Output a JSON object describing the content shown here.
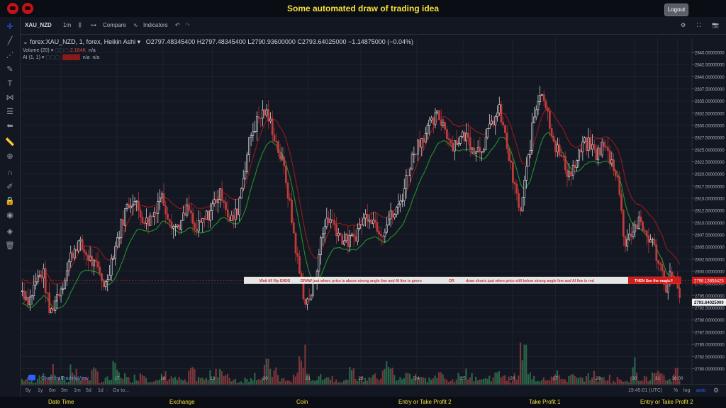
{
  "header": {
    "title": "Some automated draw of trading idea",
    "logout_label": "Logout"
  },
  "toolbar": {
    "symbol": "XAU_NZD",
    "interval": "1m",
    "compare_label": "Compare",
    "indicators_label": "Indicators"
  },
  "legend": {
    "symbol_line": "forex:XAU_NZD, 1, forex, Heikin Ashi",
    "ohlc": "O2797.48345400  H2797.48345400  L2790.93600000  C2793.64025000  −1.14875000 (−0.04%)",
    "volume_label": "Volume (20)",
    "volume_value": "2.164K",
    "volume_na": "n/a",
    "ai_label": "AI (1, 1)",
    "ai_value1": "n/a",
    "ai_value2": "n/a"
  },
  "annotation": {
    "text1": "Wait till flip ENDS",
    "text2": "DRAW just when:  price is above strong angle line and AI line is green",
    "text3": "OR",
    "text4": "draw shorts just when price still below strong angle line and AI line is red",
    "text5": "THEN See the magic!!"
  },
  "price_axis": {
    "ticks": [
      "2845.00000000",
      "2842.50000000",
      "2840.00000000",
      "2837.50000000",
      "2835.00000000",
      "2832.50000000",
      "2830.00000000",
      "2827.50000000",
      "2825.00000000",
      "2822.50000000",
      "2820.00000000",
      "2817.50000000",
      "2815.00000000",
      "2812.50000000",
      "2810.00000000",
      "2807.50000000",
      "2805.00000000",
      "2802.50000000",
      "2800.00000000",
      "2797.50000000",
      "2795.00000000",
      "2792.50000000",
      "2790.00000000",
      "2787.50000000",
      "2785.00000000",
      "2782.50000000",
      "2780.00000000"
    ],
    "label_red": "2798.13858425",
    "label_current": "2793.64025000"
  },
  "time_axis": {
    "labels": [
      "16",
      "17",
      "18",
      "19",
      "20",
      "21",
      "23",
      "24",
      "25",
      "26",
      "27",
      "28",
      "30",
      "31",
      "18:00"
    ]
  },
  "bottom": {
    "ranges": [
      "5y",
      "1y",
      "6m",
      "3m",
      "1m",
      "5d",
      "1d"
    ],
    "goto": "Go to...",
    "clock": "19:45:01 (UTC)",
    "percent": "%",
    "log": "log",
    "auto": "auto"
  },
  "watermark": "Chart by TradingView",
  "footer": {
    "columns": [
      "Date Time",
      "Exchange",
      "Coin",
      "Entry or Take Profit 2",
      "Take Profit 1",
      "Entry or Take Profit 2"
    ]
  },
  "chart_data": {
    "type": "candlestick",
    "ylim": [
      2778.9,
      2847.9
    ],
    "current_price": 2793.64025,
    "red_line_price": 2798.13858425,
    "close_path": [
      2796,
      2794,
      2798,
      2800,
      2791,
      2795,
      2798,
      2803,
      2806,
      2804,
      2802,
      2800,
      2797,
      2803,
      2808,
      2813,
      2815,
      2812,
      2810,
      2812,
      2816,
      2812,
      2809,
      2810,
      2813,
      2808,
      2810,
      2812,
      2815,
      2816,
      2810,
      2812,
      2820,
      2828,
      2831,
      2833,
      2830,
      2825,
      2820,
      2810,
      2800,
      2793,
      2796,
      2805,
      2811,
      2810,
      2807,
      2806,
      2807,
      2810,
      2812,
      2810,
      2808,
      2811,
      2812,
      2816,
      2822,
      2826,
      2828,
      2830,
      2832,
      2830,
      2826,
      2827,
      2828,
      2826,
      2825,
      2827,
      2831,
      2833,
      2826,
      2818,
      2812,
      2822,
      2832,
      2838,
      2832,
      2826,
      2823,
      2820,
      2822,
      2826,
      2826,
      2824,
      2826,
      2823,
      2820,
      2806,
      2808,
      2810,
      2808,
      2806,
      2802,
      2797,
      2800,
      2794
    ],
    "volume_path": [
      3,
      2,
      5,
      4,
      7,
      3,
      2,
      9,
      3,
      4,
      6,
      2,
      3,
      8,
      5,
      3,
      4,
      6,
      3,
      2,
      5,
      4,
      3,
      2,
      6,
      4,
      3,
      5,
      8,
      4,
      3,
      2,
      3,
      5,
      4,
      9,
      6,
      3,
      2,
      5,
      14,
      4,
      3,
      5,
      4,
      3,
      2,
      6,
      4,
      3,
      5,
      4,
      9,
      7,
      3,
      5,
      6,
      4,
      3,
      4,
      5,
      3,
      2,
      5,
      6,
      4,
      3,
      4,
      5,
      6,
      3,
      4,
      16,
      5,
      3,
      4,
      4,
      5,
      3,
      4,
      3,
      4,
      5,
      3,
      4,
      2,
      3,
      3,
      10,
      4,
      3,
      5,
      4,
      3,
      7,
      4
    ]
  }
}
